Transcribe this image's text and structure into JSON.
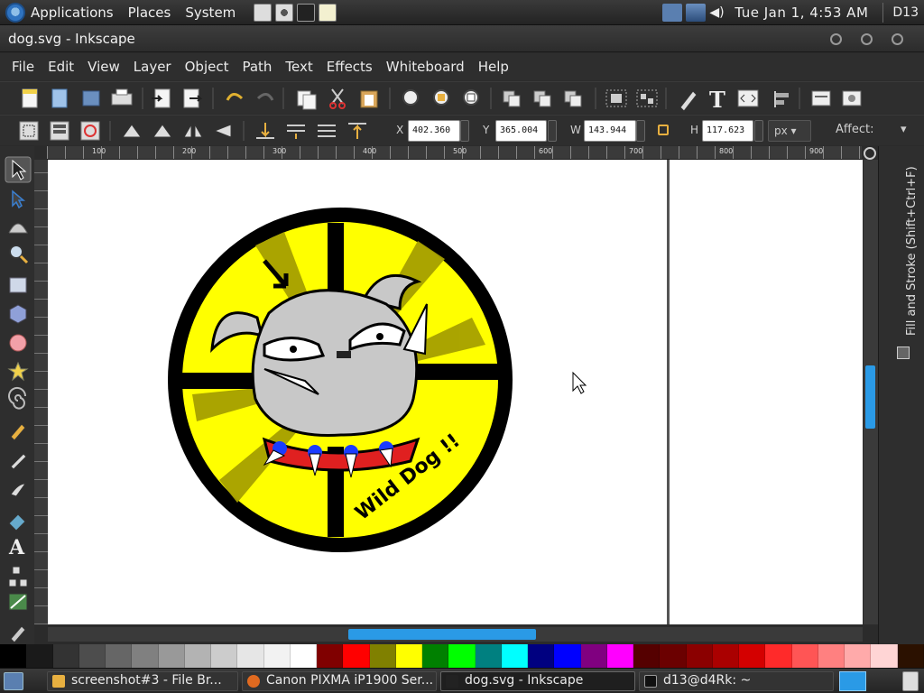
{
  "panel": {
    "menus": [
      "Applications",
      "Places",
      "System"
    ],
    "clock": "Tue Jan  1,  4:53 AM",
    "user": "D13"
  },
  "window": {
    "title": "dog.svg - Inkscape"
  },
  "menubar": [
    "File",
    "Edit",
    "View",
    "Layer",
    "Object",
    "Path",
    "Text",
    "Effects",
    "Whiteboard",
    "Help"
  ],
  "controls": {
    "x_label": "X",
    "x_value": "402.360",
    "y_label": "Y",
    "y_value": "365.004",
    "w_label": "W",
    "w_value": "143.944",
    "h_label": "H",
    "h_value": "117.623",
    "unit": "px",
    "affect_label": "Affect:"
  },
  "rulers": {
    "h_ticks": [
      "100",
      "200",
      "300",
      "400",
      "500",
      "600",
      "700",
      "800",
      "900"
    ]
  },
  "drawing": {
    "badge_text": "Wild Dog !!"
  },
  "dock": {
    "label": "Fill and Stroke (Shift+Ctrl+F)"
  },
  "palette": [
    "#000000",
    "#1a1a1a",
    "#333333",
    "#4d4d4d",
    "#666666",
    "#808080",
    "#999999",
    "#b3b3b3",
    "#cccccc",
    "#e6e6e6",
    "#f2f2f2",
    "#ffffff",
    "#800000",
    "#ff0000",
    "#808000",
    "#ffff00",
    "#008000",
    "#00ff00",
    "#008080",
    "#00ffff",
    "#000080",
    "#0000ff",
    "#800080",
    "#ff00ff",
    "#550000",
    "#6b0000",
    "#8b0000",
    "#aa0000",
    "#d40000",
    "#ff2a2a",
    "#ff5555",
    "#ff8080",
    "#ffaaaa",
    "#ffd5d5",
    "#2b1100"
  ],
  "taskbar": [
    {
      "label": "screenshot#3 - File Br..."
    },
    {
      "label": "Canon PIXMA iP1900 Ser..."
    },
    {
      "label": "dog.svg - Inkscape"
    },
    {
      "label": "d13@d4Rk: ~"
    }
  ]
}
